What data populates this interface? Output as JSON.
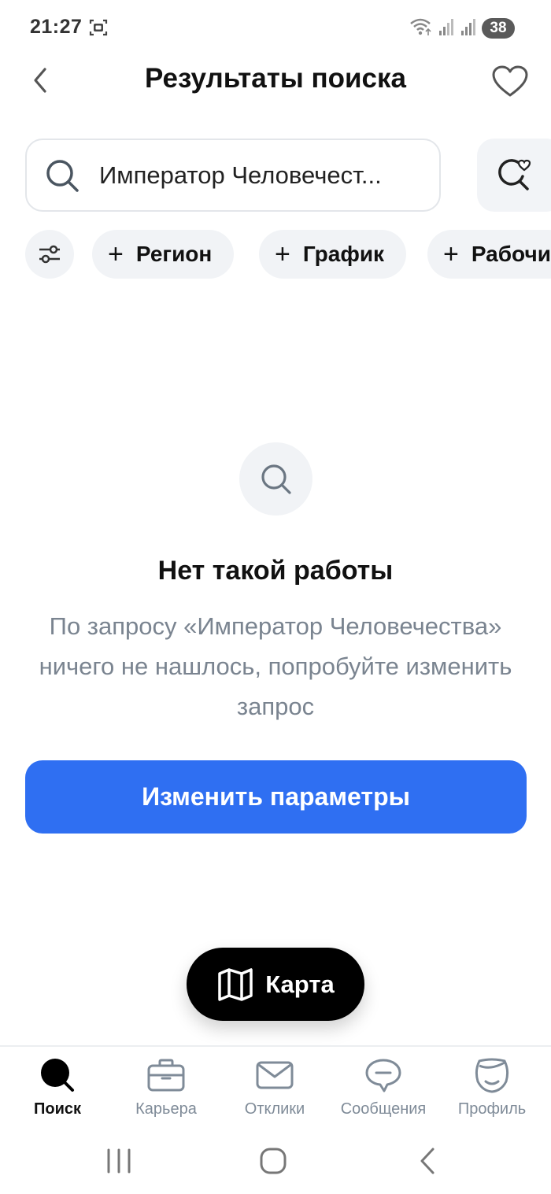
{
  "status_bar": {
    "time": "21:27",
    "battery": "38"
  },
  "header": {
    "title": "Результаты поиска"
  },
  "search": {
    "query": "Император Человечест..."
  },
  "chips": [
    {
      "label": "Регион"
    },
    {
      "label": "График"
    },
    {
      "label": "Рабочи"
    }
  ],
  "empty_state": {
    "title": "Нет такой работы",
    "description": "По запросу «Император Человечества» ничего не нашлось, попробуйте изменить запрос"
  },
  "primary_button": {
    "label": "Изменить параметры"
  },
  "map_button": {
    "label": "Карта"
  },
  "bottom_nav": {
    "items": [
      {
        "label": "Поиск",
        "icon": "search-icon"
      },
      {
        "label": "Карьера",
        "icon": "briefcase-icon"
      },
      {
        "label": "Отклики",
        "icon": "envelope-icon"
      },
      {
        "label": "Сообщения",
        "icon": "chat-icon"
      },
      {
        "label": "Профиль",
        "icon": "profile-icon"
      }
    ]
  },
  "colors": {
    "accent": "#2f6ff2",
    "chip_bg": "#f1f3f6",
    "muted_text": "#7a8490",
    "nav_inactive": "#7f8b98"
  }
}
